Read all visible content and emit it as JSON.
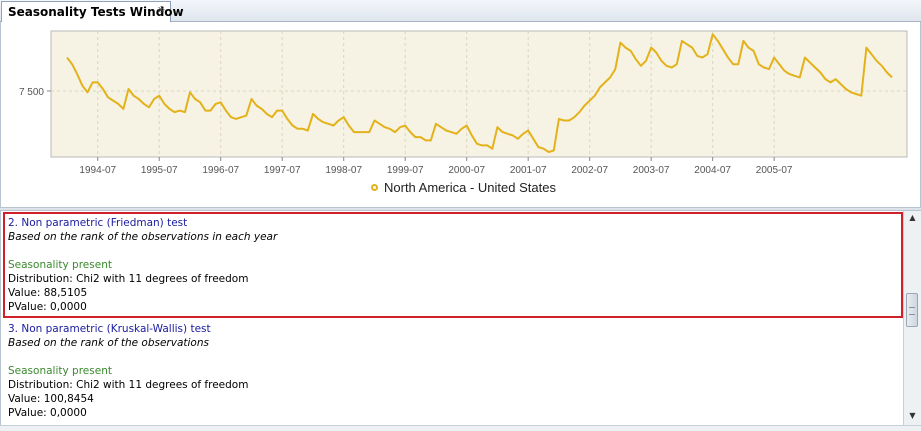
{
  "window": {
    "title": "Seasonality Tests Window",
    "close_glyph": "※"
  },
  "chart_data": {
    "type": "line",
    "x_tick_labels": [
      "1994-07",
      "1995-07",
      "1996-07",
      "1997-07",
      "1998-07",
      "1999-07",
      "2000-07",
      "2001-07",
      "2002-07",
      "2003-07",
      "2004-07",
      "2005-07"
    ],
    "y_tick_labels": [
      "7 500"
    ],
    "series": [
      {
        "name": "North America - United States",
        "color": "#e3b21b",
        "start": "1994-01",
        "frequency": "monthly",
        "values": [
          9.0,
          8.6,
          8.0,
          7.3,
          6.9,
          7.5,
          7.5,
          7.1,
          6.6,
          6.4,
          6.2,
          5.9,
          7.1,
          6.7,
          6.5,
          6.2,
          6.0,
          6.5,
          6.7,
          6.2,
          5.9,
          5.7,
          5.8,
          5.7,
          6.9,
          6.5,
          6.3,
          5.8,
          5.8,
          6.2,
          6.3,
          5.8,
          5.4,
          5.3,
          5.4,
          5.5,
          6.5,
          6.1,
          5.9,
          5.6,
          5.4,
          5.8,
          5.8,
          5.3,
          4.9,
          4.7,
          4.7,
          4.6,
          5.6,
          5.3,
          5.1,
          5.0,
          4.9,
          5.2,
          5.4,
          4.9,
          4.5,
          4.5,
          4.5,
          4.5,
          5.2,
          5.0,
          4.8,
          4.7,
          4.5,
          4.8,
          4.9,
          4.5,
          4.2,
          4.2,
          4.0,
          4.0,
          5.0,
          4.8,
          4.6,
          4.5,
          4.4,
          4.7,
          4.9,
          4.3,
          3.8,
          3.7,
          3.7,
          3.5,
          4.8,
          4.5,
          4.4,
          4.3,
          4.1,
          4.4,
          4.6,
          4.1,
          3.6,
          3.5,
          3.3,
          3.4,
          5.3,
          5.2,
          5.2,
          5.4,
          5.7,
          6.1,
          6.4,
          6.7,
          7.2,
          7.5,
          7.8,
          8.3,
          9.9,
          9.6,
          9.4,
          8.9,
          8.5,
          8.8,
          9.6,
          9.3,
          8.8,
          8.5,
          8.4,
          8.6,
          10.0,
          9.8,
          9.6,
          9.1,
          9.0,
          9.2,
          10.4,
          10.0,
          9.5,
          9.0,
          8.6,
          8.6,
          10.0,
          9.6,
          9.4,
          8.6,
          8.4,
          8.3,
          9.0,
          8.6,
          8.2,
          8.0,
          7.9,
          7.8,
          9.0,
          8.7,
          8.4,
          8.1,
          7.7,
          7.5,
          7.7,
          7.4,
          7.1,
          6.9,
          6.8,
          6.7,
          9.6,
          9.2,
          8.8,
          8.5,
          8.1,
          7.8
        ],
        "approx_units": "relative (y axis shows only 7 500 tick)"
      }
    ],
    "grid": true,
    "legend_position": "bottom-center"
  },
  "results": {
    "tests": [
      {
        "title": "2. Non parametric (Friedman) test",
        "description": "Based on the rank of the observations in each year",
        "status": "Seasonality present",
        "distribution": "Distribution: Chi2 with 11 degrees of freedom",
        "value": "Value: 88,5105",
        "pvalue": "PValue: 0,0000",
        "highlighted": true
      },
      {
        "title": "3. Non parametric (Kruskal-Wallis) test",
        "description": "Based on the rank of the observations",
        "status": "Seasonality present",
        "distribution": "Distribution: Chi2 with 11 degrees of freedom",
        "value": "Value: 100,8454",
        "pvalue": "PValue: 0,0000",
        "highlighted": false
      }
    ]
  },
  "scrollbar": {
    "up_arrow": "▲",
    "down_arrow": "▼"
  },
  "colors": {
    "highlight_border": "#d0212b",
    "test_title": "#1a1aa0",
    "status_green": "#3b8a2e",
    "plot_background": "#f6f3e4",
    "series_color": "#e3b21b"
  }
}
